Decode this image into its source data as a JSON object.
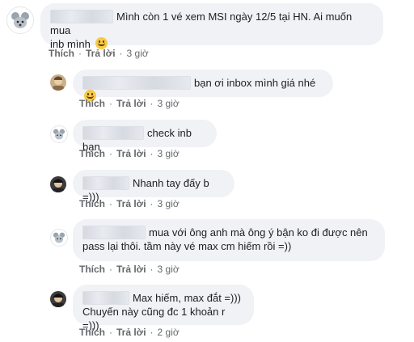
{
  "comments": [
    {
      "text": "Mình còn 1 vé xem MSI ngày 12/5 tại HN. Ai muốn mua",
      "text2": "inb mình",
      "like": "Thích",
      "reply": "Trả lời",
      "time": "3 giờ"
    },
    {
      "text": "bạn ơi inbox mình giá nhé",
      "like": "Thích",
      "reply": "Trả lời",
      "time": "3 giờ"
    },
    {
      "text": "check inb bạn",
      "like": "Thích",
      "reply": "Trả lời",
      "time": "3 giờ"
    },
    {
      "text": "Nhanh tay đấy b =)))",
      "like": "Thích",
      "reply": "Trả lời",
      "time": "3 giờ"
    },
    {
      "text": "mua với ông anh mà ông ý bận ko đi được nên",
      "text2": "pass lại thôi. tầm này vé max cm hiếm rồi =))",
      "like": "Thích",
      "reply": "Trả lời",
      "time": "3 giờ"
    },
    {
      "text": "Max hiếm, max đắt =)))",
      "text2": "Chuyến này cũng đc 1 khoản r =)))",
      "like": "Thích",
      "reply": "Trả lời",
      "time": "2 giờ"
    }
  ],
  "separator": "·",
  "icons": {
    "mouse": "mouse-avatar-icon",
    "cat": "cat-avatar-icon",
    "person": "person-avatar-icon",
    "smile": "smile-emoji-icon"
  }
}
